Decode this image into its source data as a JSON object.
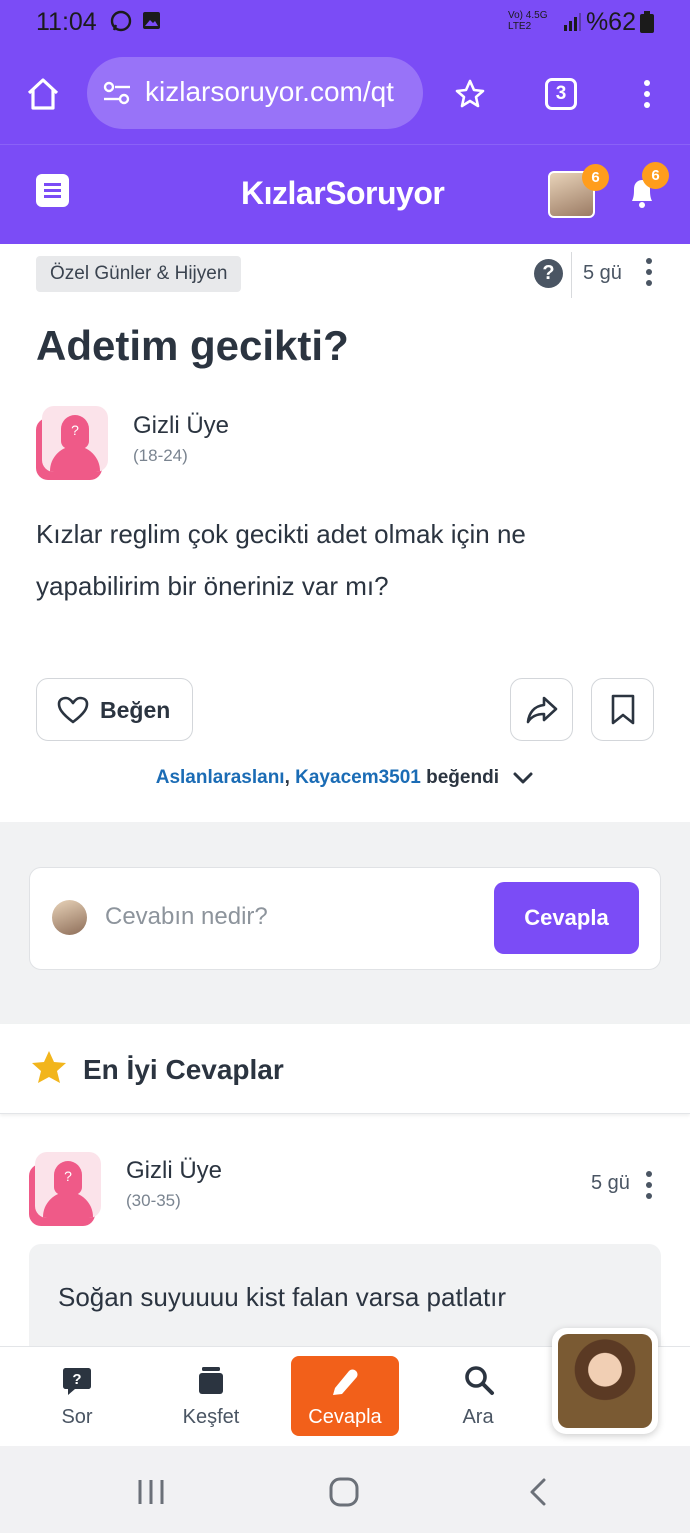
{
  "status_bar": {
    "time": "11:04",
    "network": "Vo) 4.5G LTE2",
    "battery": "%62"
  },
  "browser": {
    "url": "kizlarsoruyor.com/qt",
    "tab_count": "3"
  },
  "site": {
    "logo": "KızlarSoruyor",
    "avatar_badge": "6",
    "notification_badge": "6"
  },
  "question": {
    "category": "Özel Günler & Hijyen",
    "help": "?",
    "age": "5 gü",
    "title": "Adetim gecikti?",
    "author": "Gizli Üye",
    "author_age": "(18-24)",
    "body": "Kızlar reglim çok gecikti adet olmak için ne yapabilirim bir öneriniz var mı?",
    "like_label": "Beğen",
    "liked_by": {
      "user1": "Aslanlaraslanı",
      "separator": ", ",
      "user2": "Kayacem3501",
      "suffix": " beğendi"
    }
  },
  "answer_form": {
    "placeholder": "Cevabın nedir?",
    "submit_label": "Cevapla"
  },
  "best_answers": {
    "heading": "En İyi Cevaplar",
    "items": [
      {
        "author": "Gizli Üye",
        "author_age": "(30-35)",
        "age": "5 gü",
        "text": "Soğan suyuuuu kist falan varsa patlatır"
      }
    ]
  },
  "bottom_nav": {
    "items": [
      {
        "label": "Sor",
        "icon": "question-bubble-icon"
      },
      {
        "label": "Keşfet",
        "icon": "cards-stack-icon"
      },
      {
        "label": "Cevapla",
        "icon": "pencil-icon",
        "active": true
      },
      {
        "label": "Ara",
        "icon": "search-icon"
      }
    ]
  },
  "colors": {
    "brand": "#7b4cf6",
    "active_nav": "#f2601a",
    "link": "#1b6cb5",
    "badge": "#ff9d1c"
  }
}
